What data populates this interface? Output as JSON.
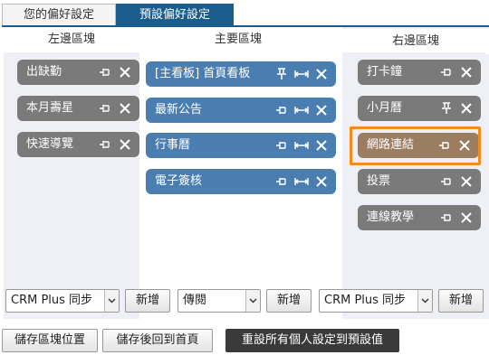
{
  "tabs": [
    {
      "label": "您的偏好設定",
      "active": false
    },
    {
      "label": "預設偏好設定",
      "active": true
    }
  ],
  "columns": {
    "left": {
      "title": "左邊區塊",
      "widgets": [
        {
          "label": "出缺勤"
        },
        {
          "label": "本月壽星"
        },
        {
          "label": "快速導覽"
        }
      ]
    },
    "main": {
      "title": "主要區塊",
      "widgets": [
        {
          "label": "[主看板] 首頁看板"
        },
        {
          "label": "最新公告"
        },
        {
          "label": "行事曆"
        },
        {
          "label": "電子簽核"
        }
      ]
    },
    "right": {
      "title": "右邊區塊",
      "widgets": [
        {
          "label": "打卡鐘"
        },
        {
          "label": "小月曆"
        },
        {
          "label": "網路連結"
        },
        {
          "label": "投票"
        },
        {
          "label": "連線教學"
        }
      ]
    }
  },
  "add_controls": {
    "left": {
      "selected": "CRM Plus 同步",
      "add_label": "新增"
    },
    "main": {
      "selected": "傳閱",
      "add_label": "新增"
    },
    "right": {
      "selected": "CRM Plus 同步",
      "add_label": "新增"
    }
  },
  "actions": {
    "save_position": "儲存區塊位置",
    "save_and_home": "儲存後回到首頁",
    "reset_all": "重設所有個人設定到預設值"
  },
  "colors": {
    "active_tab": "#1a5c8b",
    "widget_gray": "#7a7a7a",
    "widget_blue": "#4a7eb0",
    "widget_brown": "#9b7e62",
    "highlight": "#f38c1f"
  }
}
